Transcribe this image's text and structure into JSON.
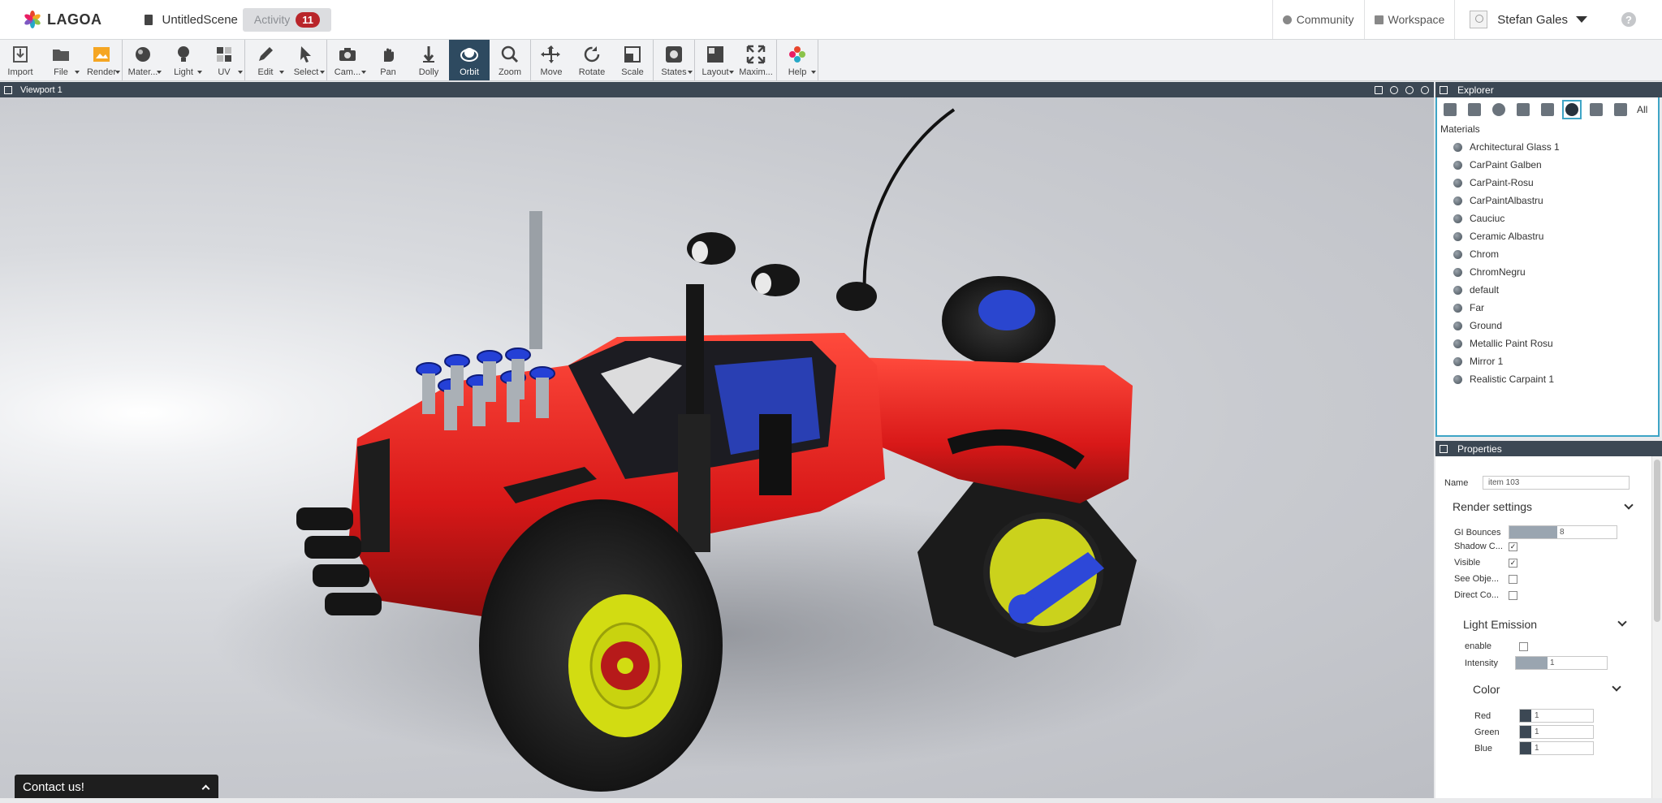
{
  "app": {
    "logo_text": "LAGOA",
    "scene_name": "UntitledScene",
    "activity_label": "Activity",
    "activity_count": "11"
  },
  "top_nav": {
    "community": "Community",
    "workspace": "Workspace",
    "user_name": "Stefan Gales",
    "help": "?"
  },
  "toolbar": {
    "groups": [
      [
        {
          "label": "Import",
          "icon": "import-icon"
        },
        {
          "label": "File",
          "icon": "folder-icon",
          "dropdown": true
        },
        {
          "label": "Render",
          "icon": "render-icon",
          "dropdown": true
        }
      ],
      [
        {
          "label": "Mater...",
          "icon": "material-icon",
          "dropdown": true
        },
        {
          "label": "Light",
          "icon": "light-icon",
          "dropdown": true
        },
        {
          "label": "UV",
          "icon": "uv-icon",
          "dropdown": true
        }
      ],
      [
        {
          "label": "Edit",
          "icon": "pencil-icon",
          "dropdown": true
        },
        {
          "label": "Select",
          "icon": "cursor-icon",
          "dropdown": true
        }
      ],
      [
        {
          "label": "Cam...",
          "icon": "camera-icon",
          "dropdown": true
        },
        {
          "label": "Pan",
          "icon": "hand-icon"
        },
        {
          "label": "Dolly",
          "icon": "dolly-icon"
        },
        {
          "label": "Orbit",
          "icon": "orbit-icon",
          "active": true
        },
        {
          "label": "Zoom",
          "icon": "zoom-icon"
        }
      ],
      [
        {
          "label": "Move",
          "icon": "move-icon"
        },
        {
          "label": "Rotate",
          "icon": "rotate-icon"
        },
        {
          "label": "Scale",
          "icon": "scale-icon"
        }
      ],
      [
        {
          "label": "States",
          "icon": "states-icon",
          "dropdown": true
        }
      ],
      [
        {
          "label": "Layout",
          "icon": "layout-icon",
          "dropdown": true
        },
        {
          "label": "Maxim...",
          "icon": "maximize-icon"
        }
      ],
      [
        {
          "label": "Help",
          "icon": "help-logo-icon",
          "dropdown": true
        }
      ]
    ]
  },
  "viewport": {
    "title": "Viewport 1",
    "contact_label": "Contact us!"
  },
  "explorer": {
    "title": "Explorer",
    "filter_all": "All",
    "section_title": "Materials",
    "materials": [
      "Architectural Glass 1",
      "CarPaint Galben",
      "CarPaint-Rosu",
      "CarPaintAlbastru",
      "Cauciuc",
      "Ceramic Albastru",
      "Chrom",
      "ChromNegru",
      "default",
      "Far",
      "Ground",
      "Metallic Paint Rosu",
      "Mirror 1",
      "Realistic Carpaint 1"
    ]
  },
  "properties": {
    "title": "Properties",
    "name_label": "Name",
    "name_value": "item 103",
    "render_settings": {
      "title": "Render settings",
      "gi_bounces_label": "GI Bounces",
      "gi_bounces_value": "8",
      "gi_bounces_fill": 0.45,
      "shadow_label": "Shadow C...",
      "shadow_checked": true,
      "visible_label": "Visible",
      "visible_checked": true,
      "see_label": "See Obje...",
      "see_checked": false,
      "direct_label": "Direct Co...",
      "direct_checked": false
    },
    "light_emission": {
      "title": "Light Emission",
      "enable_label": "enable",
      "enable_checked": false,
      "intensity_label": "Intensity",
      "intensity_value": "1",
      "intensity_fill": 0.35
    },
    "color": {
      "title": "Color",
      "red_label": "Red",
      "red_value": "1",
      "green_label": "Green",
      "green_value": "1",
      "blue_label": "Blue",
      "blue_value": "1"
    }
  },
  "colors": {
    "header_dark": "#3c4854",
    "accent": "#3ea5c6",
    "active_button": "#2e4a60",
    "badge": "#b9252a",
    "car_red": "#e01f1f",
    "rim_yellow": "#d6e10a",
    "part_blue": "#1f3fd1"
  }
}
